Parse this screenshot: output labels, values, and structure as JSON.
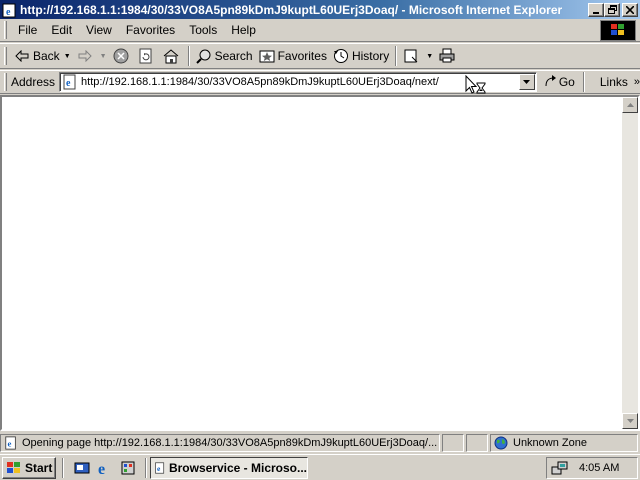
{
  "window": {
    "title": "http://192.168.1.1:1984/30/33VO8A5pn89kDmJ9kuptL60UErj3Doaq/ - Microsoft Internet Explorer",
    "controls": {
      "minimize_icon": "minimize-icon",
      "maximize_icon": "restore-icon",
      "close_icon": "close-icon"
    }
  },
  "menu": {
    "items": [
      "File",
      "Edit",
      "View",
      "Favorites",
      "Tools",
      "Help"
    ]
  },
  "toolbar": {
    "back_label": "Back",
    "search_label": "Search",
    "favorites_label": "Favorites",
    "history_label": "History"
  },
  "address": {
    "label": "Address",
    "url": "http://192.168.1.1:1984/30/33VO8A5pn89kDmJ9kuptL60UErj3Doaq/next/",
    "go_label": "Go",
    "links_label": "Links",
    "links_chevron": "»"
  },
  "status": {
    "message": "Opening page http://192.168.1.1:1984/30/33VO8A5pn89kDmJ9kuptL60UErj3Doaq/...",
    "zone": "Unknown Zone"
  },
  "taskbar": {
    "start_label": "Start",
    "task_label": "Browservice - Microso...",
    "clock": "4:05 AM"
  },
  "colors": {
    "titlebar_start": "#0a246a",
    "titlebar_end": "#a6caf0",
    "chrome": "#d4d0c8"
  }
}
